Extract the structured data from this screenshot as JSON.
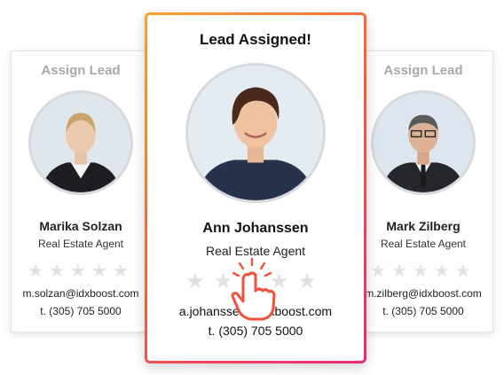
{
  "cards": {
    "left": {
      "title": "Assign Lead",
      "name": "Marika Solzan",
      "role": "Real Estate Agent",
      "stars": "★★★★★",
      "email": "m.solzan@idxboost.com",
      "phone": "t. (305) 705 5000"
    },
    "center": {
      "title": "Lead Assigned!",
      "name": "Ann Johanssen",
      "role": "Real Estate Agent",
      "stars": "★★★★★",
      "email": "a.johanssen@idxboost.com",
      "phone": "t. (305) 705 5000"
    },
    "right": {
      "title": "Assign Lead",
      "name": "Mark Zilberg",
      "role": "Real Estate Agent",
      "stars": "★★★★★",
      "email": "m.zilberg@idxboost.com",
      "phone": "t. (305) 705 5000"
    }
  },
  "icons": {
    "cursor": "tap-hand-icon",
    "rating": "star-icon"
  },
  "colors": {
    "highlight_gradient_start": "#f6a233",
    "highlight_gradient_end": "#e8297b",
    "title_muted": "#a9a9a9",
    "star_empty": "#e1e1e1"
  }
}
